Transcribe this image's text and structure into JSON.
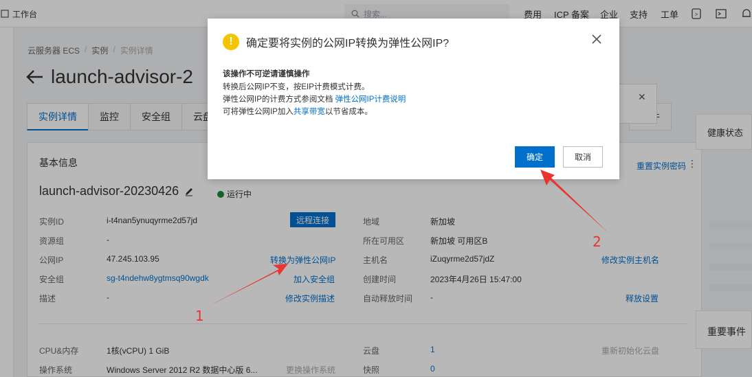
{
  "topbar": {
    "home_label": "工作台",
    "search_placeholder": "搜索...",
    "nav": [
      "费用",
      "ICP 备案",
      "企业",
      "支持",
      "工单"
    ]
  },
  "breadcrumb": [
    "云服务器 ECS",
    "实例",
    "实例详情"
  ],
  "page_title": "launch-advisor-2",
  "tabs": [
    "实例详情",
    "监控",
    "安全组",
    "云盘"
  ],
  "tab_event": "事件",
  "card": {
    "title": "基本信息",
    "reset_password": "重置实例密码",
    "instance_name": "launch-advisor-20230426",
    "status": "运行中",
    "remote_connect": "远程连接",
    "left_fields": [
      {
        "label": "实例ID",
        "value": "i-t4nan5ynuqyrme2d57jd"
      },
      {
        "label": "资源组",
        "value": "-"
      },
      {
        "label": "公网IP",
        "value": "47.245.103.95",
        "action": "转换为弹性公网IP"
      },
      {
        "label": "安全组",
        "value": "sg-t4ndehw8ygtmsq90wgdk",
        "action": "加入安全组"
      },
      {
        "label": "描述",
        "value": "-",
        "action": "修改实例描述"
      }
    ],
    "right_fields": [
      {
        "label": "地域",
        "value": "新加坡"
      },
      {
        "label": "所在可用区",
        "value": "新加坡 可用区B"
      },
      {
        "label": "主机名",
        "value": "iZuqyrme2d57jdZ",
        "action": "修改实例主机名"
      },
      {
        "label": "创建时间",
        "value": "2023年4月26日 15:47:00"
      },
      {
        "label": "自动释放时间",
        "value": "-",
        "action": "释放设置"
      }
    ],
    "bottom_left": [
      {
        "label": "CPU&内存",
        "value": "1核(vCPU) 1 GiB"
      },
      {
        "label": "操作系统",
        "value": "Windows Server 2012 R2 数据中心版 6...",
        "action": "更换操作系统"
      }
    ],
    "bottom_right": [
      {
        "label": "云盘",
        "value": "1",
        "action": "重新初始化云盘"
      },
      {
        "label": "快照",
        "value": "0"
      }
    ]
  },
  "side": {
    "health": "健康状态",
    "important_events": "重要事件"
  },
  "dialog": {
    "title": "确定要将实例的公网IP转换为弹性公网IP?",
    "warning_heading": "该操作不可逆请谨慎操作",
    "line1": "转换后公网IP不变，按EIP计费模式计费。",
    "line2_prefix": "弹性公网IP的计费方式参阅文档 ",
    "line2_link": "弹性公网IP计费说明",
    "line3_prefix": "可将弹性公网IP加入",
    "line3_link": "共享带宽",
    "line3_suffix": "以节省成本。",
    "ok_label": "确定",
    "cancel_label": "取消"
  },
  "annotations": {
    "step1": "1",
    "step2": "2",
    "color": "#e8352f"
  }
}
